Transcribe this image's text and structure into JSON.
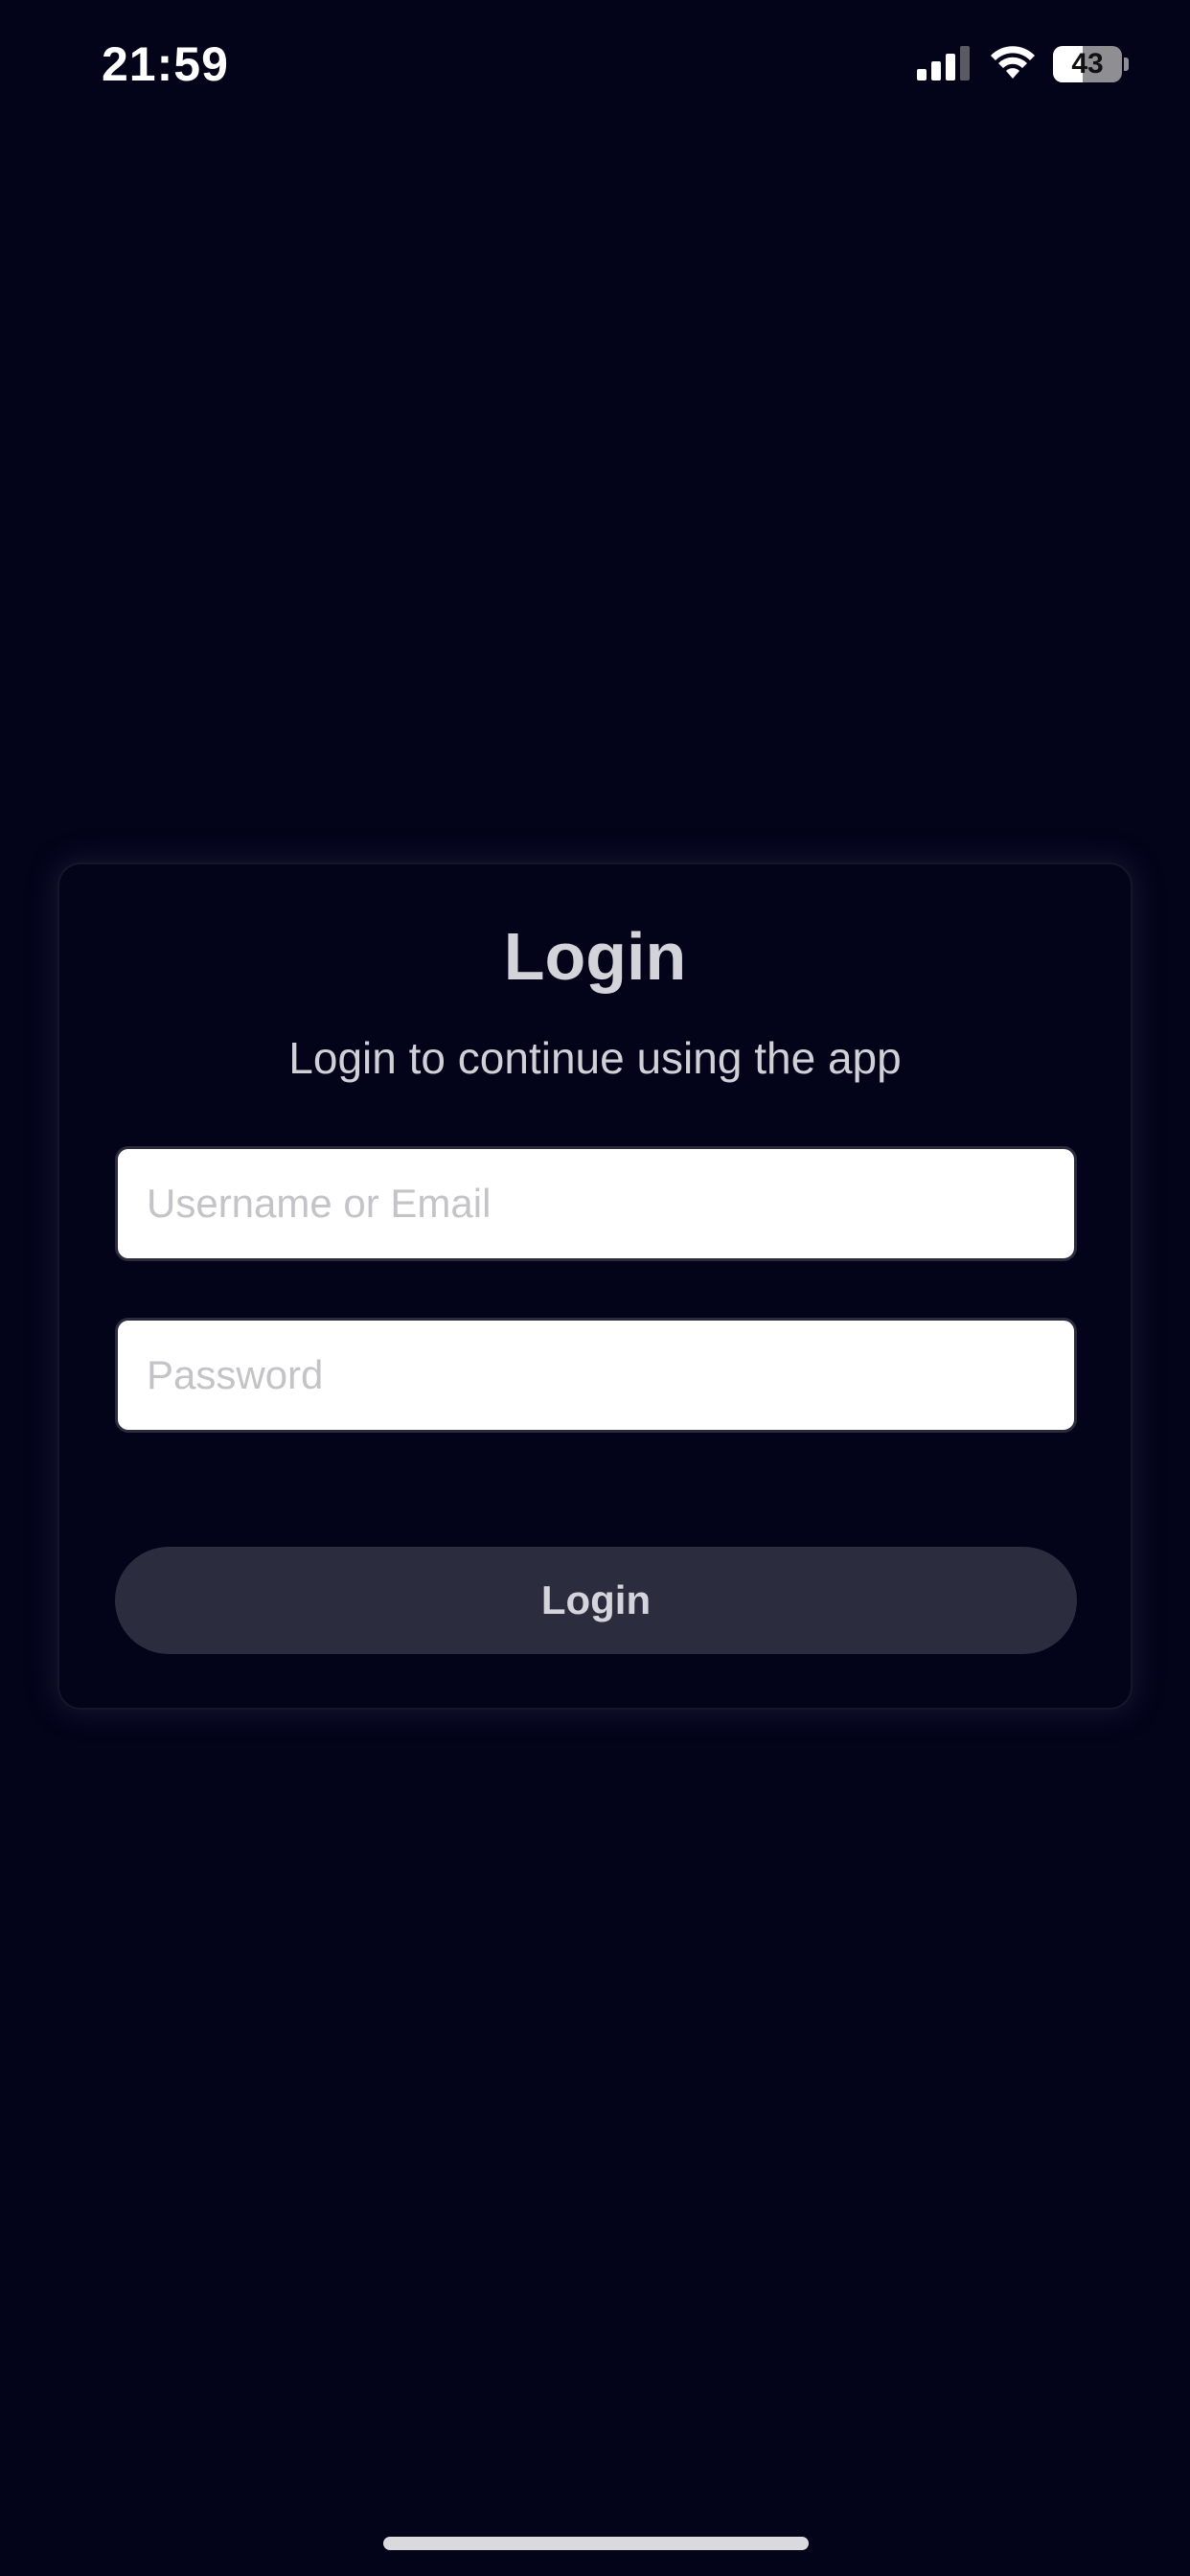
{
  "status_bar": {
    "time": "21:59",
    "battery_level": "43",
    "battery_fraction": 0.43,
    "icons": [
      "signal-icon",
      "wifi-icon",
      "battery-icon"
    ]
  },
  "login": {
    "title": "Login",
    "subtitle": "Login to continue using the app",
    "username_placeholder": "Username or Email",
    "password_placeholder": "Password",
    "button_label": "Login"
  },
  "colors": {
    "background": "#03031a",
    "button": "#2b2d3e",
    "text_light": "#d3d3da",
    "placeholder": "#c4c4c8"
  }
}
